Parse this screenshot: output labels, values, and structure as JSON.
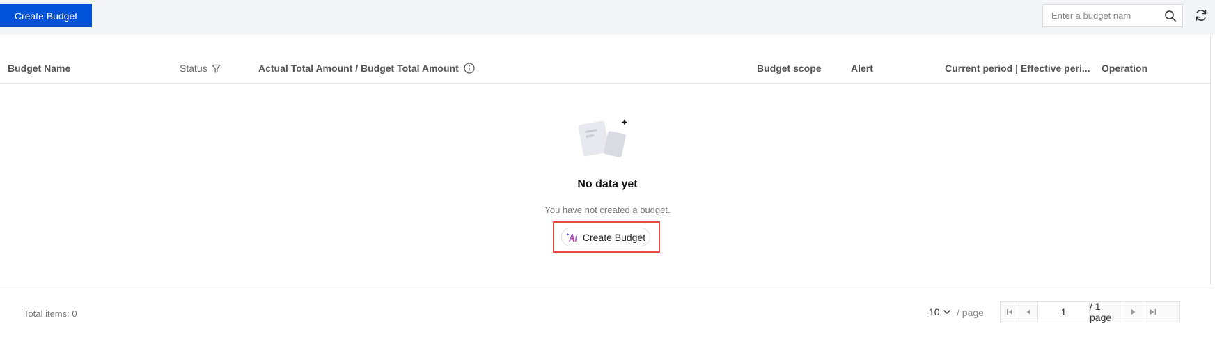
{
  "toolbar": {
    "create_label": "Create Budget",
    "search_placeholder": "Enter a budget nam"
  },
  "table": {
    "columns": [
      "Budget Name",
      "Status",
      "Actual Total Amount / Budget Total Amount",
      "Budget scope",
      "Alert",
      "Current period | Effective peri...",
      "Operation"
    ]
  },
  "empty": {
    "title": "No data yet",
    "description": "You have not created a budget.",
    "action_label": "Create Budget"
  },
  "footer": {
    "total_label": "Total items: 0",
    "page_size": "10",
    "per_page_label": "/ page",
    "current_page": "1",
    "total_pages_label": "/ 1 page"
  },
  "colors": {
    "primary": "#0052d9",
    "highlight": "#e34d42"
  },
  "icons": {
    "search": "search-icon",
    "refresh": "refresh-icon",
    "filter": "filter-icon",
    "info": "info-icon",
    "ai": "ai-sparkle-icon"
  }
}
